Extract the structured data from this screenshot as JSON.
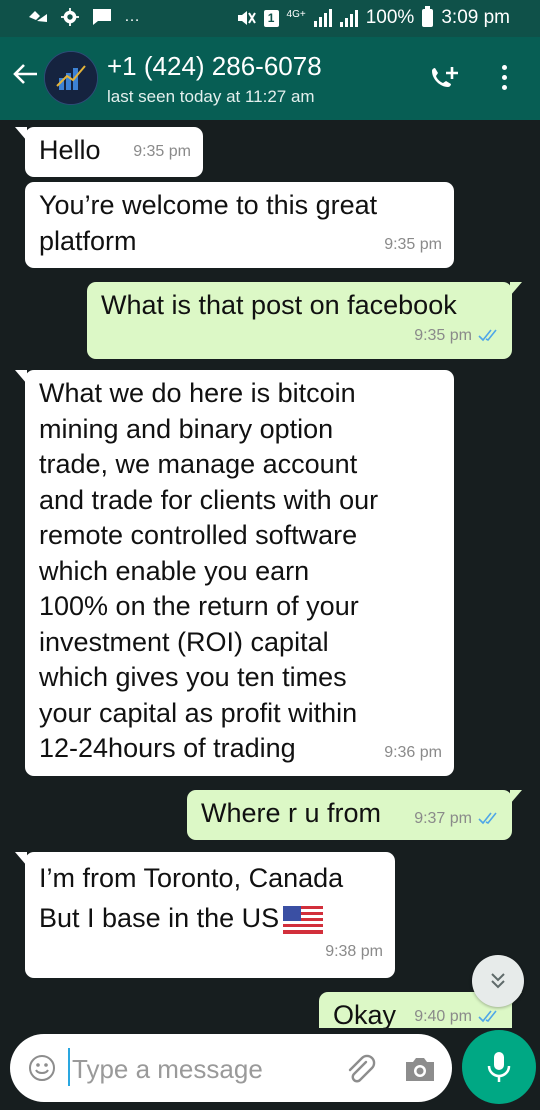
{
  "status_bar": {
    "battery": "100%",
    "time": "3:09 pm",
    "network": "4G+",
    "sim": "1",
    "dots": "…"
  },
  "header": {
    "contact_name": "+1 (424) 286-6078",
    "last_seen": "last seen today at 11:27 am"
  },
  "messages": [
    {
      "direction": "in",
      "text": "Hello",
      "time": "9:35 pm"
    },
    {
      "direction": "in",
      "text": "You’re welcome to this great\nplatform",
      "time": "9:35 pm"
    },
    {
      "direction": "out",
      "text": "What is that post on facebook",
      "time": "9:35 pm",
      "status": "read"
    },
    {
      "direction": "in",
      "text": "What we do here is bitcoin\nmining and binary option\ntrade, we manage account\nand trade for clients with our\nremote controlled software\nwhich enable you earn\n100% on the return of your\ninvestment (ROI) capital\nwhich gives you ten times\nyour capital as profit within\n12-24hours of trading",
      "time": "9:36 pm"
    },
    {
      "direction": "out",
      "text": "Where r u from",
      "time": "9:37 pm",
      "status": "read"
    },
    {
      "direction": "in",
      "text": "I’m from Toronto, Canada\nBut I base in the US",
      "emoji": "us-flag",
      "time": "9:38 pm"
    },
    {
      "direction": "out",
      "text": "Okay",
      "time": "9:40 pm",
      "status": "read"
    }
  ],
  "composer": {
    "placeholder": "Type a message",
    "value": ""
  },
  "icons": {
    "back": "back-arrow-icon",
    "add_call": "add-call-icon",
    "menu": "more-vert-icon",
    "emoji": "emoji-icon",
    "attach": "attach-icon",
    "camera": "camera-icon",
    "mic": "mic-icon",
    "scroll_down": "double-chevron-down-icon",
    "read_receipt": "double-check-icon"
  },
  "colors": {
    "header": "#075e54",
    "status_bar": "#0f5149",
    "outgoing_bubble": "#dcf8c6",
    "incoming_bubble": "#ffffff",
    "chat_background": "#171e1f",
    "mic_button": "#00a884",
    "read_ticks": "#4fa6e8"
  }
}
